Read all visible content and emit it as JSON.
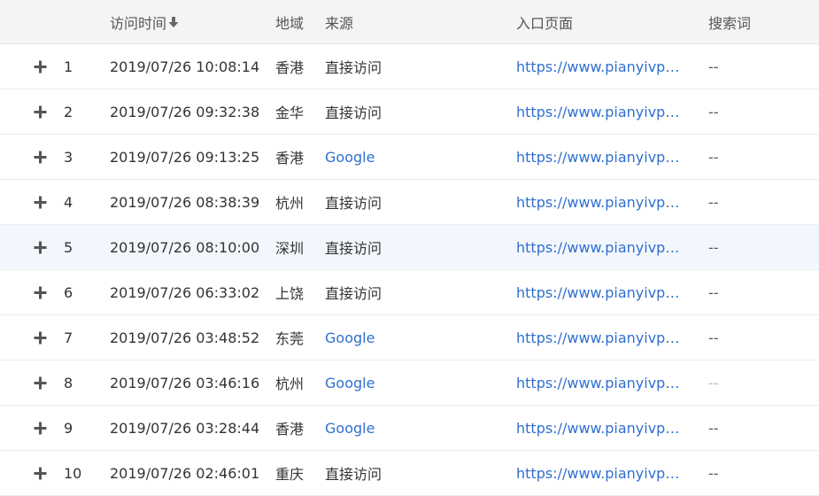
{
  "header": {
    "visit_time": "访问时间",
    "region": "地域",
    "source": "来源",
    "landing_page": "入口页面",
    "keyword": "搜索词",
    "sort_icon": "arrow-down-icon"
  },
  "colors": {
    "header_bg": "#f4f4f6",
    "link": "#2f6fd0",
    "highlight_row": "#f3f7fd"
  },
  "rows": [
    {
      "index": "1",
      "time": "2019/07/26 10:08:14",
      "region": "香港",
      "source": "直接访问",
      "landing": "https://www.pianyivps.com",
      "keyword": "--"
    },
    {
      "index": "2",
      "time": "2019/07/26 09:32:38",
      "region": "金华",
      "source": "直接访问",
      "landing": "https://www.pianyivps.c...",
      "keyword": "--"
    },
    {
      "index": "3",
      "time": "2019/07/26 09:13:25",
      "region": "香港",
      "source": "Google",
      "landing": "https://www.pianyivps.c...",
      "keyword": "--"
    },
    {
      "index": "4",
      "time": "2019/07/26 08:38:39",
      "region": "杭州",
      "source": "直接访问",
      "landing": "https://www.pianyivps.com",
      "keyword": "--"
    },
    {
      "index": "5",
      "time": "2019/07/26 08:10:00",
      "region": "深圳",
      "source": "直接访问",
      "landing": "https://www.pianyivps.c...",
      "keyword": "--"
    },
    {
      "index": "6",
      "time": "2019/07/26 06:33:02",
      "region": "上饶",
      "source": "直接访问",
      "landing": "https://www.pianyivps.c...",
      "keyword": "--"
    },
    {
      "index": "7",
      "time": "2019/07/26 03:48:52",
      "region": "东莞",
      "source": "Google",
      "landing": "https://www.pianyivps.c...",
      "keyword": "--"
    },
    {
      "index": "8",
      "time": "2019/07/26 03:46:16",
      "region": "杭州",
      "source": "Google",
      "landing": "https://www.pianyivps.c...",
      "keyword": "--"
    },
    {
      "index": "9",
      "time": "2019/07/26 03:28:44",
      "region": "香港",
      "source": "Google",
      "landing": "https://www.pianyivps.com",
      "keyword": "--"
    },
    {
      "index": "10",
      "time": "2019/07/26 02:46:01",
      "region": "重庆",
      "source": "直接访问",
      "landing": "https://www.pianyivps.com",
      "keyword": "--"
    }
  ]
}
